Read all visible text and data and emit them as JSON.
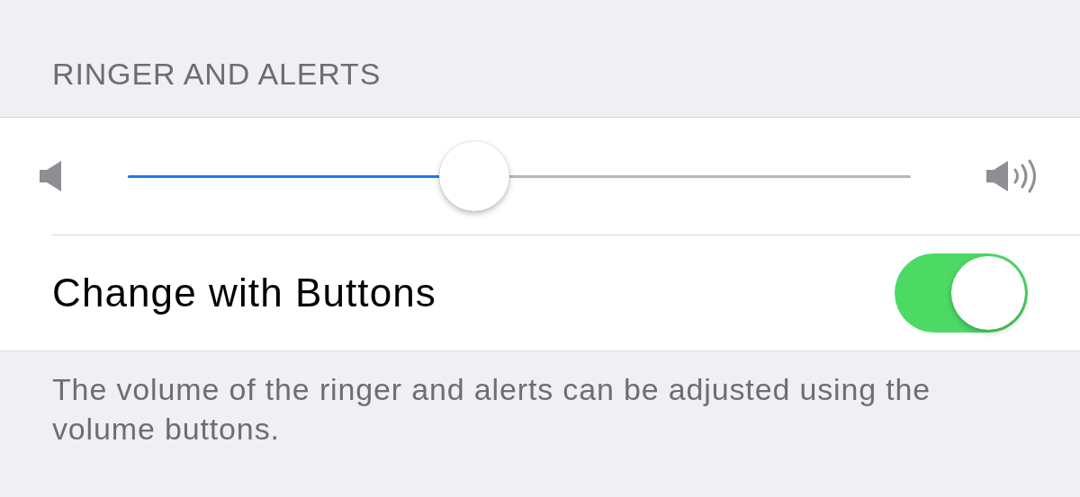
{
  "section": {
    "header": "RINGER AND ALERTS"
  },
  "volume_slider": {
    "level": 0.443
  },
  "toggle_row": {
    "label": "Change with Buttons",
    "on": true
  },
  "footer": "The volume of the ringer and alerts can be adjusted using the volume buttons."
}
